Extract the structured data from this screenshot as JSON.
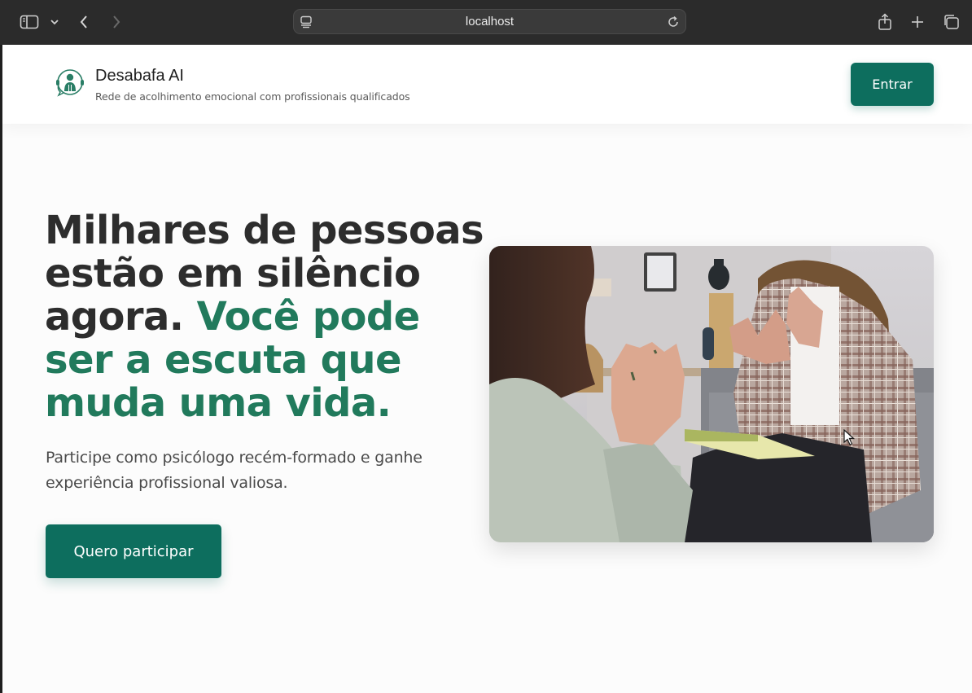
{
  "browser": {
    "url": "localhost",
    "icons": [
      "sidebar-icon",
      "chevron-down-icon",
      "back-icon",
      "forward-icon",
      "page-icon",
      "reload-icon",
      "share-icon",
      "plus-icon",
      "tabs-icon"
    ]
  },
  "header": {
    "brand_name": "Desabafa AI",
    "brand_subtitle": "Rede de acolhimento emocional com profissionais qualificados",
    "login_label": "Entrar"
  },
  "hero": {
    "headline_dark": "Milhares de pessoas estão em silêncio agora.",
    "headline_accent": "Você pode ser a escuta que muda uma vida.",
    "subtext": "Participe como psicólogo recém-formado e ganhe experiência profissional valiosa.",
    "cta_label": "Quero participar"
  },
  "colors": {
    "primary": "#0d6e5e",
    "accent_text": "#217a5c",
    "heading": "#2d2d2d"
  }
}
